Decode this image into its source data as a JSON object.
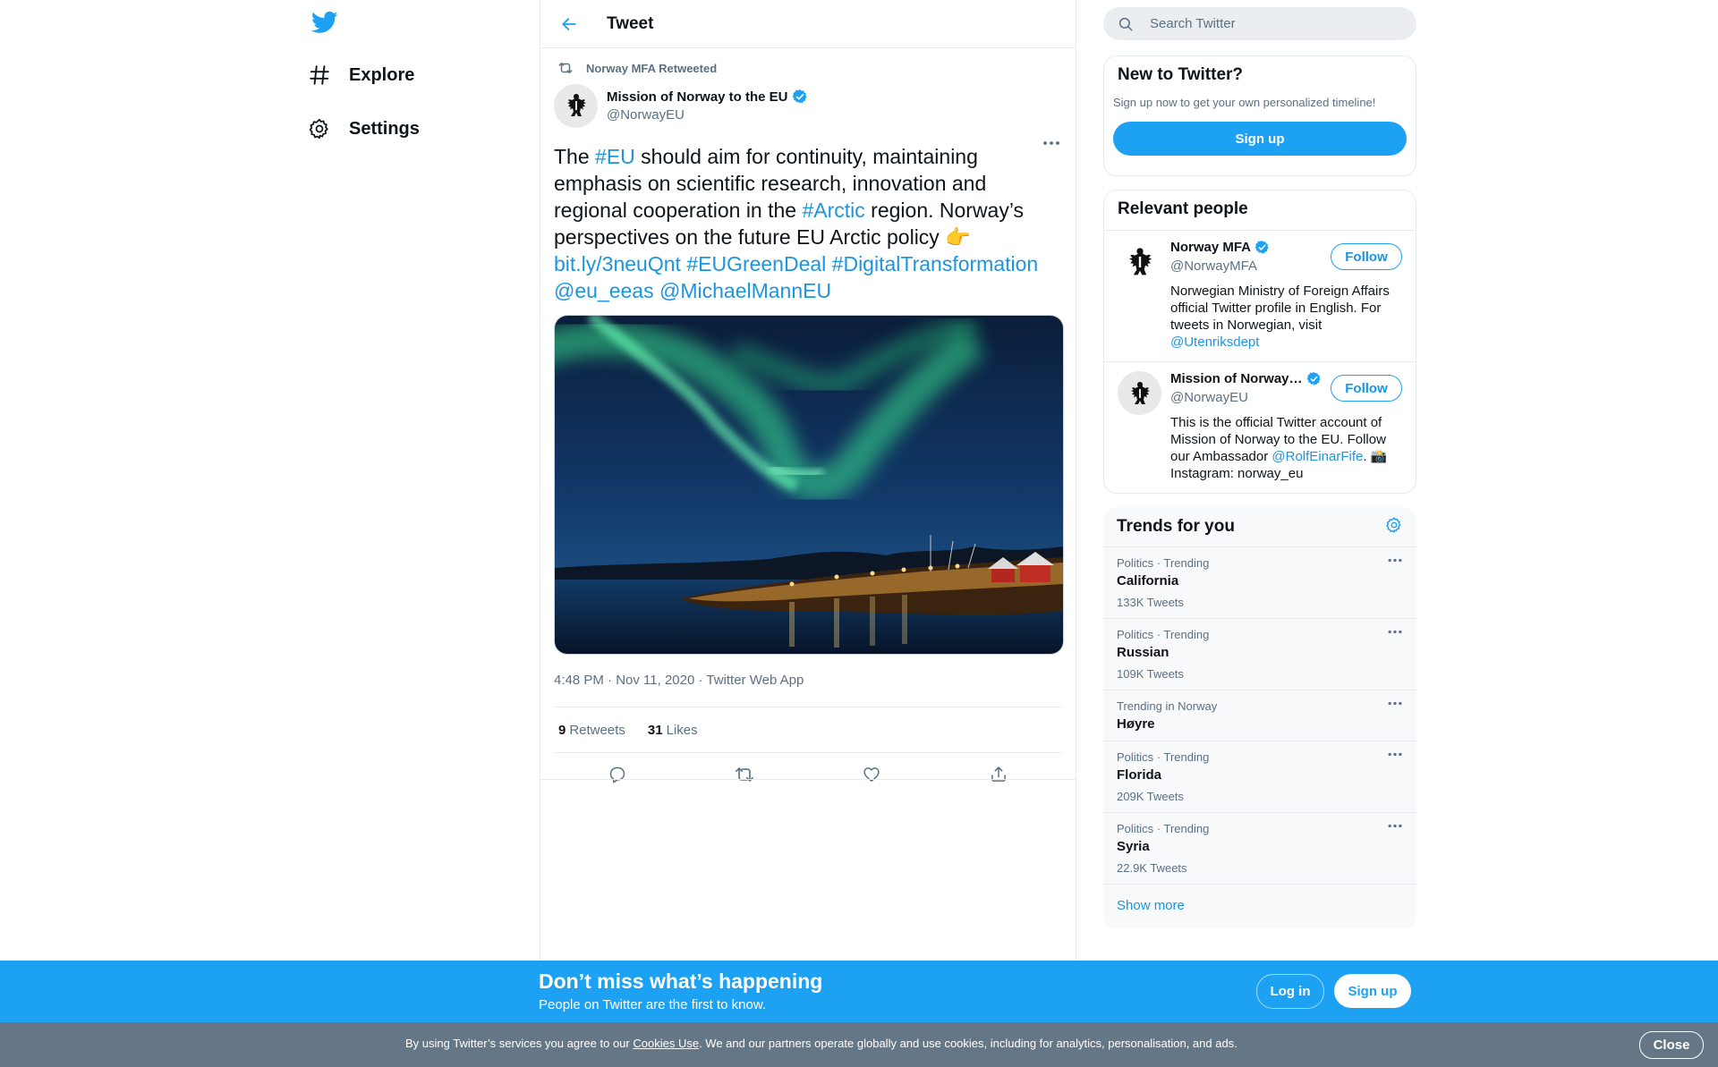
{
  "nav": {
    "items": [
      {
        "label": "Explore",
        "icon": "hashtag-icon"
      },
      {
        "label": "Settings",
        "icon": "gear-icon"
      }
    ]
  },
  "header": {
    "title": "Tweet"
  },
  "tweet": {
    "retweeted_by": "Norway MFA Retweeted",
    "author_name": "Mission of Norway to the EU",
    "author_handle": "@NorwayEU",
    "text": {
      "p1": "The ",
      "h1": "#EU",
      "p2": " should aim for continuity, maintaining emphasis on scientific research, innovation and regional cooperation in the ",
      "h2": "#Arctic",
      "p3": " region. Norway’s perspectives on the future EU Arctic policy 👉",
      "link": "bit.ly/3neuQnt",
      "h3": "#EUGreenDeal",
      "h4": "#DigitalTransformation",
      "m1": "@eu_eeas",
      "m2": "@MichaelMannEU"
    },
    "meta": "4:48 PM · Nov 11, 2020 · Twitter Web App",
    "retweets": "9",
    "retweets_label": "Retweets",
    "likes": "31",
    "likes_label": "Likes"
  },
  "search": {
    "placeholder": "Search Twitter"
  },
  "new_to_twitter": {
    "title": "New to Twitter?",
    "subtitle": "Sign up now to get your own personalized timeline!",
    "signup": "Sign up"
  },
  "relevant": {
    "title": "Relevant people",
    "people": [
      {
        "name": "Norway MFA",
        "handle": "@NorwayMFA",
        "follow": "Follow",
        "bio": "Norwegian Ministry of Foreign Affairs official Twitter profile in English. For tweets in Norwegian, visit ",
        "bio_link": "@Utenriksdept"
      },
      {
        "name": "Mission of Norway…",
        "handle": "@NorwayEU",
        "follow": "Follow",
        "bio1": "This is the official Twitter account of Mission of Norway to the EU. Follow our Ambassador ",
        "bio_link": "@RolfEinarFife",
        "bio2": ". 📸 Instagram: norway_eu"
      }
    ]
  },
  "trends": {
    "title": "Trends for you",
    "items": [
      {
        "context": "Politics · Trending",
        "name": "California",
        "count": "133K Tweets"
      },
      {
        "context": "Politics · Trending",
        "name": "Russian",
        "count": "109K Tweets"
      },
      {
        "context": "Trending in Norway",
        "name": "Høyre",
        "count": ""
      },
      {
        "context": "Politics · Trending",
        "name": "Florida",
        "count": "209K Tweets"
      },
      {
        "context": "Politics · Trending",
        "name": "Syria",
        "count": "22.9K Tweets"
      }
    ],
    "show_more": "Show more"
  },
  "banner": {
    "title": "Don’t miss what’s happening",
    "subtitle": "People on Twitter are the first to know.",
    "login": "Log in",
    "signup": "Sign up"
  },
  "cookie": {
    "pre": "By using Twitter’s services you agree to our ",
    "link": "Cookies Use",
    "post": ". We and our partners operate globally and use cookies, including for analytics, personalisation, and ads.",
    "close": "Close"
  },
  "colors": {
    "accent": "#1da1f2",
    "link": "#1b95e0",
    "secondary_text": "#5b7083",
    "cookie_bg": "#657786"
  }
}
